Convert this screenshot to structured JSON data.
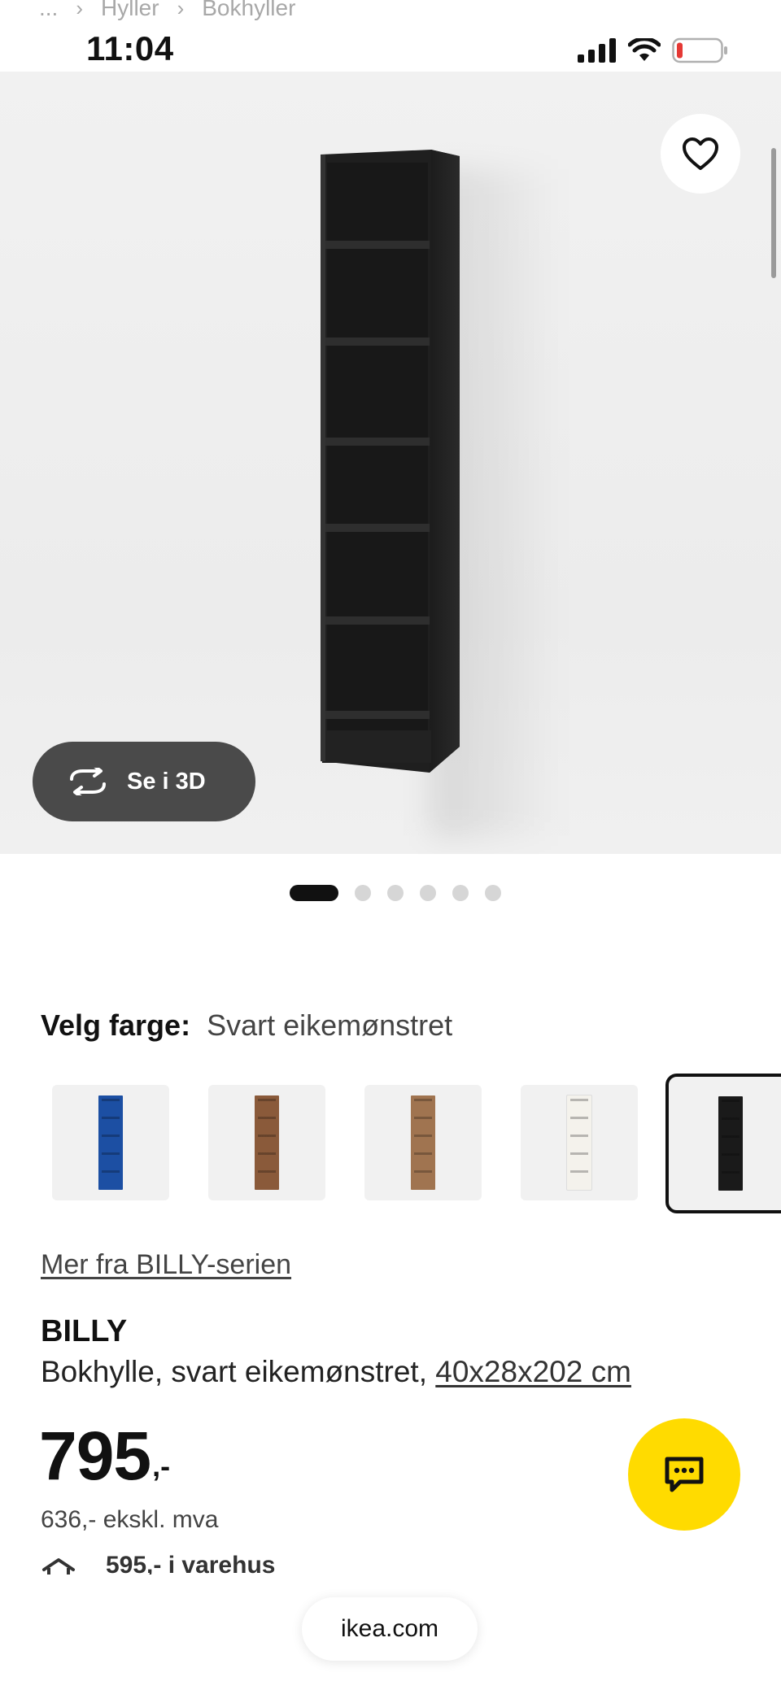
{
  "breadcrumb": {
    "ellipsis": "...",
    "items": [
      "Hyller",
      "Bokhyller"
    ]
  },
  "status_bar": {
    "time": "11:04",
    "icons": [
      "signal-icon",
      "wifi-icon",
      "battery-low-icon"
    ]
  },
  "gallery": {
    "favorite_icon": "heart-outline-icon",
    "view_3d_label": "Se i 3D",
    "view_3d_icon": "rotate-3d-icon",
    "image_count": 6,
    "active_image": 1
  },
  "color_picker": {
    "label": "Velg farge:",
    "selected_value": "Svart eikemønstret",
    "swatches": [
      {
        "color": "#1c4fa3",
        "icon": "bookcase-blue"
      },
      {
        "color": "#8a5a3a",
        "icon": "bookcase-brown"
      },
      {
        "color": "#a07450",
        "icon": "bookcase-oak"
      },
      {
        "color": "#f4f2ec",
        "icon": "bookcase-white"
      },
      {
        "color": "#1a1a1a",
        "icon": "bookcase-black",
        "selected": true
      }
    ]
  },
  "series_link": "Mer fra BILLY-serien",
  "product": {
    "name": "BILLY",
    "description": "Bokhylle, svart eikemønstret, ",
    "dimensions": "40x28x202 cm"
  },
  "price": {
    "value": "795",
    "suffix": ",-",
    "ex_vat": "636,- ekskl. mva"
  },
  "store": {
    "icon": "store-icon",
    "label": "595,- i varehus"
  },
  "chat": {
    "icon": "chat-icon",
    "color": "#ffdb00"
  },
  "browser": {
    "url": "ikea.com"
  }
}
